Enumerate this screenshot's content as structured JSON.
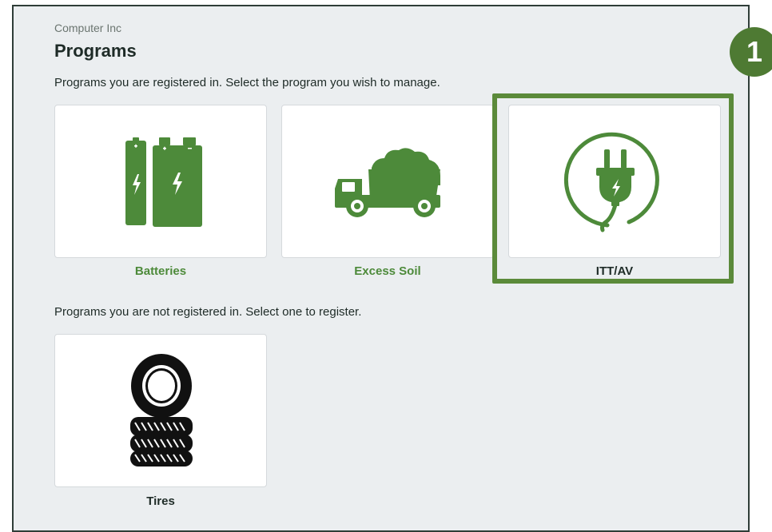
{
  "header": {
    "company": "Computer Inc",
    "title": "Programs"
  },
  "registered": {
    "instruction": "Programs you are registered in. Select the program you wish to manage.",
    "programs": [
      {
        "label": "Batteries",
        "icon": "batteries-icon"
      },
      {
        "label": "Excess Soil",
        "icon": "dump-truck-icon"
      },
      {
        "label": "ITT/AV",
        "icon": "electric-plug-icon"
      }
    ]
  },
  "unregistered": {
    "instruction": "Programs you are not registered in. Select one to register.",
    "programs": [
      {
        "label": "Tires",
        "icon": "tires-icon"
      }
    ]
  },
  "annotation": {
    "step_number": "1"
  },
  "colors": {
    "accent_green": "#4d8a3a",
    "highlight_green": "#5b8a3a",
    "badge_green": "#4e7a33",
    "panel_bg": "#ebeef0"
  }
}
